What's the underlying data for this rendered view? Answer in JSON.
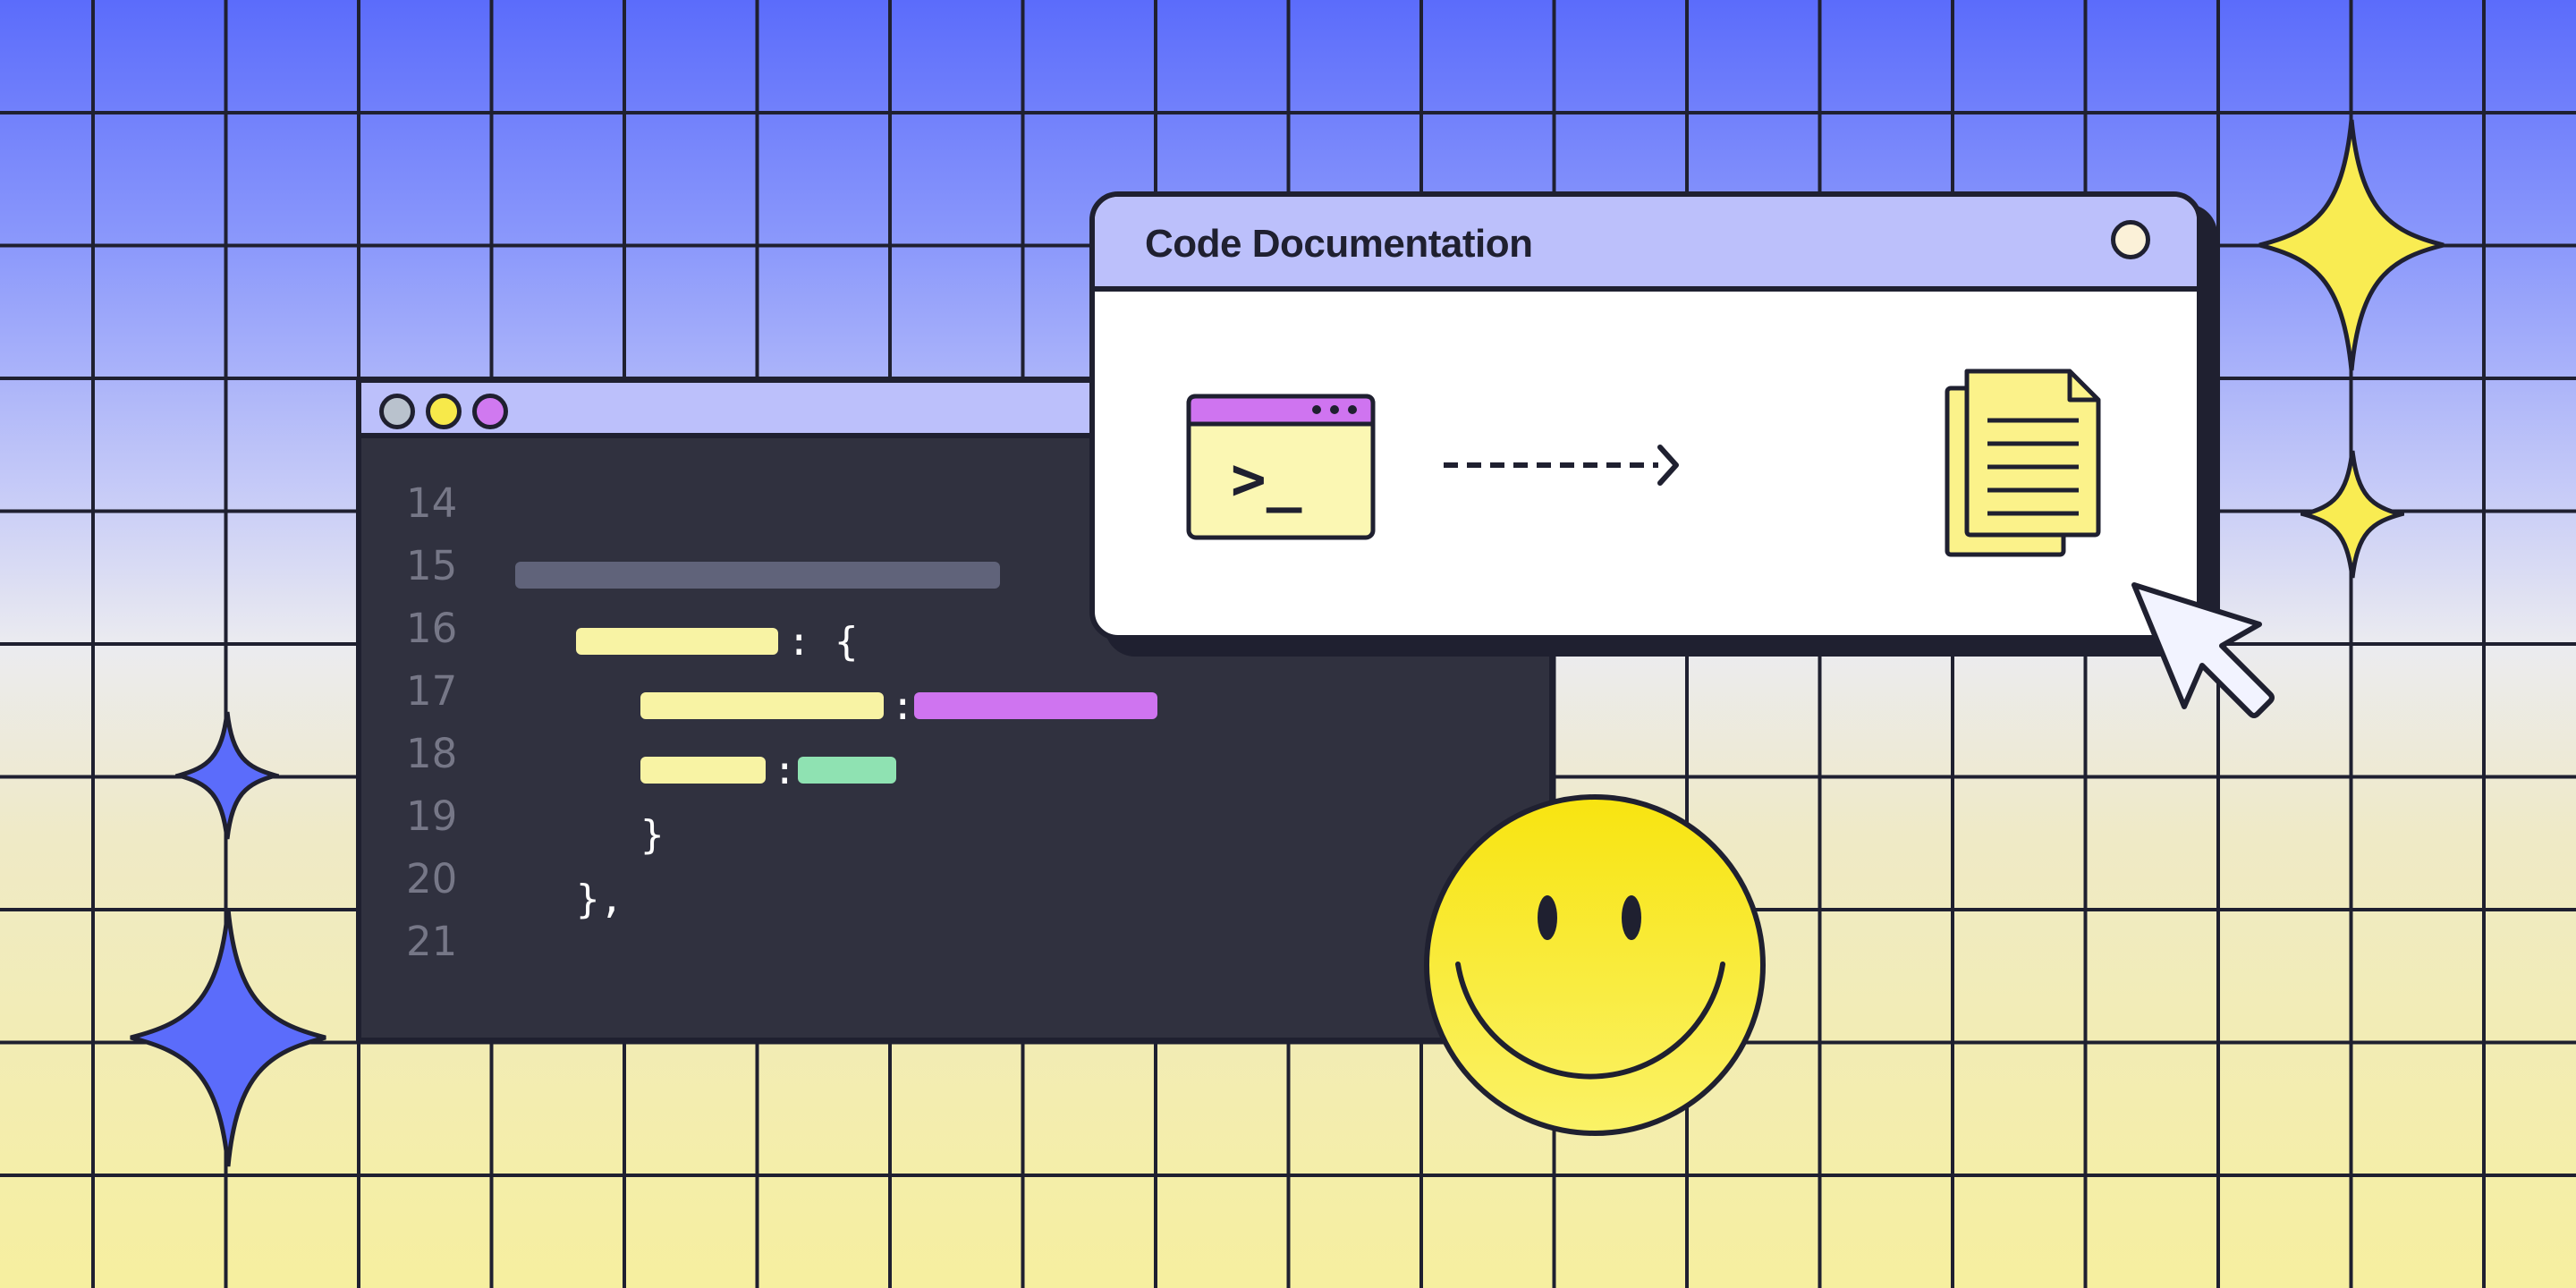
{
  "editor": {
    "line_numbers": [
      "14",
      "15",
      "16",
      "17",
      "18",
      "19",
      "20",
      "21"
    ],
    "window_dots": [
      {
        "name": "gray",
        "color": "#b9c2cd"
      },
      {
        "name": "yellow",
        "color": "#f7e94a"
      },
      {
        "name": "purple",
        "color": "#d079f0"
      }
    ],
    "code_punctuation": {
      "line16": ": {",
      "line17": ":",
      "line18": ":",
      "line19": "}",
      "line20": "},"
    },
    "colors": {
      "background": "#30313f",
      "comment_bar": "#60637a",
      "key_bar": "#f8f3a4",
      "string_bar": "#cf74f0",
      "value_bar": "#8fe2b2"
    }
  },
  "doc_window": {
    "title": "Code Documentation",
    "terminal_prompt": ">_",
    "icons": [
      "terminal-window-icon",
      "dashed-arrow-icon",
      "documents-icon",
      "close-icon"
    ]
  },
  "decorations": {
    "icons": [
      "sparkle-icon",
      "smiley-face-icon",
      "mouse-cursor-icon"
    ],
    "colors": {
      "accent_blue": "#5b6cfb",
      "accent_yellow": "#f9ec52",
      "outline": "#1f2030"
    }
  }
}
